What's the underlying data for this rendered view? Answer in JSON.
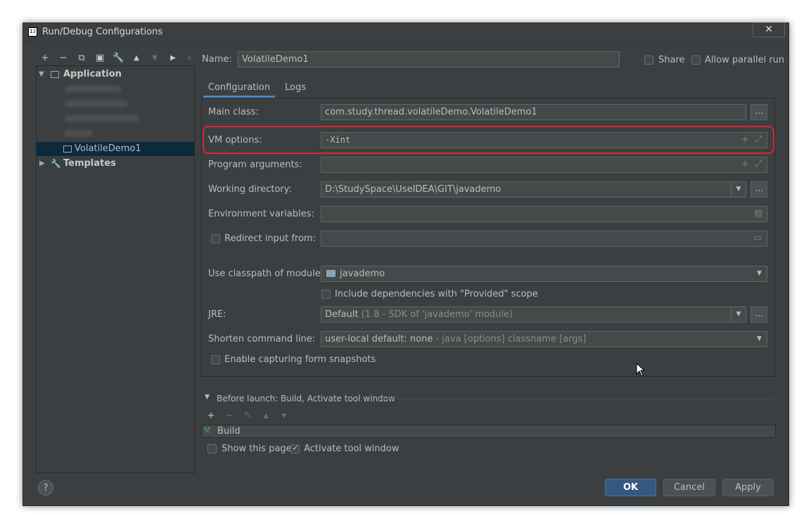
{
  "window": {
    "title": "Run/Debug Configurations",
    "close_glyph": "✕"
  },
  "toolbar": {
    "add": "+",
    "remove": "−",
    "copy": "⧉",
    "save": "▣",
    "edit": "🔧",
    "up": "▲",
    "down": "▼",
    "folder": "▶",
    "more": "»"
  },
  "tree": {
    "application_label": "Application",
    "selected_item": "VolatileDemo1",
    "templates_label": "Templates"
  },
  "name_row": {
    "label": "Name:",
    "value": "VolatileDemo1",
    "share_label": "Share",
    "parallel_label": "Allow parallel run"
  },
  "tabs": [
    {
      "label": "Configuration"
    },
    {
      "label": "Logs"
    }
  ],
  "config": {
    "main_class_label": "Main class:",
    "main_class_value": "com.study.thread.volatileDemo.VolatileDemo1",
    "vm_options_label": "VM options:",
    "vm_options_value": "-Xint",
    "program_args_label": "Program arguments:",
    "program_args_value": "",
    "working_dir_label": "Working directory:",
    "working_dir_value": "D:\\StudySpace\\UseIDEA\\GIT\\javademo",
    "env_vars_label": "Environment variables:",
    "env_vars_value": "",
    "redirect_label": "Redirect input from:",
    "redirect_value": "",
    "classpath_label": "Use classpath of module:",
    "classpath_value": "javademo",
    "include_deps_label": "Include dependencies with \"Provided\" scope",
    "jre_label": "JRE:",
    "jre_value_main": "Default",
    "jre_value_detail": "(1.8 - SDK of 'javademo' module)",
    "shorten_label": "Shorten command line:",
    "shorten_value_main": "user-local default: none",
    "shorten_value_detail": "- java [options] classname [args]",
    "snapshots_label": "Enable capturing form snapshots",
    "ellipsis": "..."
  },
  "before_launch": {
    "header": "Before launch: Build, Activate tool window",
    "build_item": "Build",
    "show_page_label": "Show this page",
    "activate_label": "Activate tool window"
  },
  "buttons": {
    "ok": "OK",
    "cancel": "Cancel",
    "apply": "Apply",
    "help": "?"
  }
}
